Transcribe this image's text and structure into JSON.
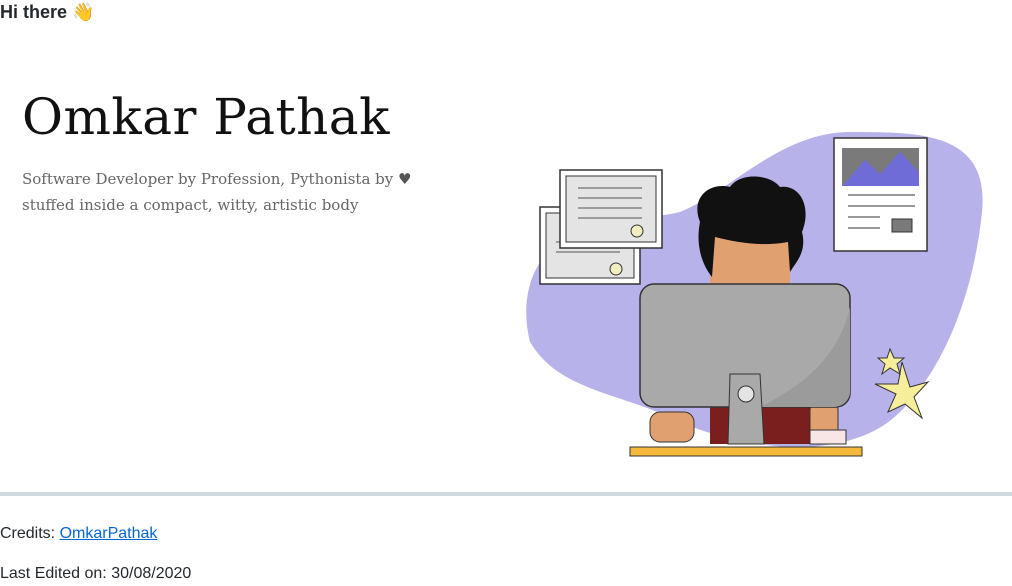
{
  "header": {
    "greeting": "Hi there",
    "wave_emoji": "👋"
  },
  "banner": {
    "name": "Omkar Pathak",
    "tagline_before_heart": "Software Developer by Profession, Pythonista by",
    "heart_glyph": "♥",
    "tagline_after_heart": "stuffed inside a compact, witty, artistic body"
  },
  "footer": {
    "credits_label": "Credits:",
    "credits_link": "OmkarPathak",
    "last_edited_label": "Last Edited on:",
    "last_edited_date": "30/08/2020"
  },
  "colors": {
    "blob": "#b7b3ea",
    "link": "#0366d6",
    "divider": "#d1d9e0"
  }
}
